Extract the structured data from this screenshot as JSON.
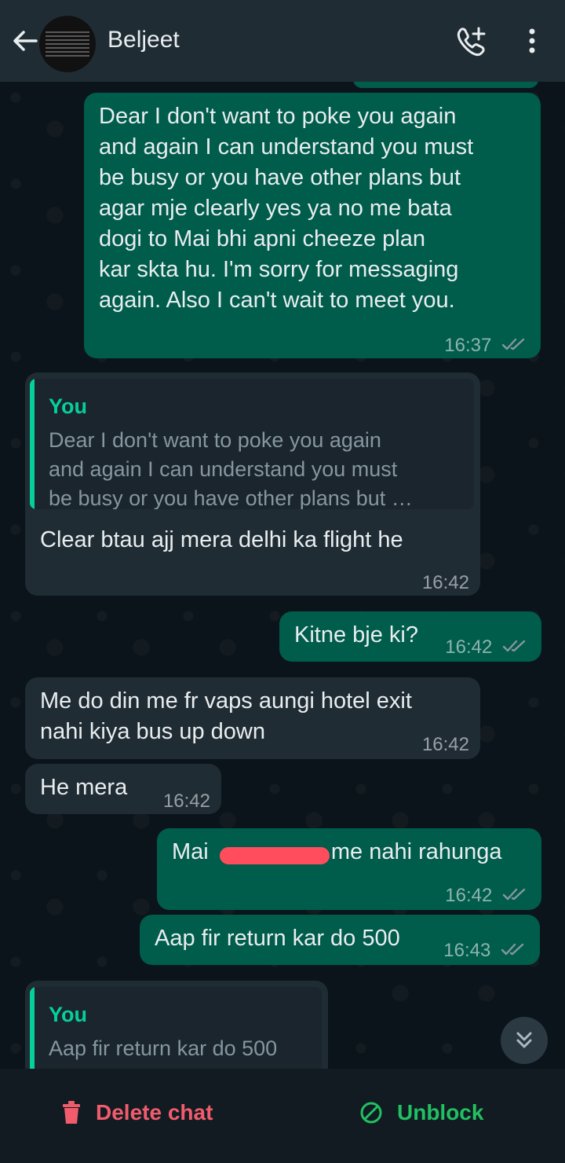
{
  "header": {
    "contact_name": "Beljeet"
  },
  "messages": [
    {
      "direction": "out",
      "text": "Dear I don't want to poke you again and again I can understand you must be busy or you have other plans but agar mje clearly yes ya no me bata dogi to Mai bhi apni cheeze plan kar skta hu. I'm sorry for messaging again. Also I can't wait to meet you.",
      "lines": [
        "Dear I don't want to poke you again",
        "and again I can understand you must",
        "be busy or you have other plans but",
        "agar mje clearly yes ya no me bata",
        "dogi to Mai bhi apni cheeze plan",
        "kar skta hu. I'm sorry for messaging",
        "again. Also I can't wait to meet you."
      ],
      "time": "16:37"
    },
    {
      "direction": "in",
      "quote_name": "You",
      "quote_lines": [
        "Dear I don't want to poke you again",
        "and again I can understand you must",
        "be busy or you have other plans but …"
      ],
      "text": "Clear btau ajj mera delhi ka flight he",
      "time": "16:42"
    },
    {
      "direction": "out",
      "text": "Kitne bje ki?",
      "time": "16:42"
    },
    {
      "direction": "in",
      "lines": [
        "Me do din me fr vaps aungi hotel exit",
        "nahi kiya bus up down"
      ],
      "time": "16:42"
    },
    {
      "direction": "in",
      "text": "He mera",
      "time": "16:42"
    },
    {
      "direction": "out",
      "text_before": "Mai",
      "text_after": "me nahi rahunga",
      "time": "16:42"
    },
    {
      "direction": "out",
      "text": "Aap fir return kar do 500",
      "time": "16:43"
    },
    {
      "direction": "in",
      "quote_name": "You",
      "quote_text": "Aap fir return kar do 500"
    }
  ],
  "bottom_bar": {
    "delete_label": "Delete chat",
    "unblock_label": "Unblock"
  },
  "colors": {
    "header_bg": "#1f2c34",
    "outgoing_bubble": "#005c4b",
    "incoming_bubble": "#1f2c34",
    "quote_accent": "#06cf9c",
    "delete_red": "#f15c6d",
    "unblock_green": "#21c063"
  },
  "icons": [
    "back-arrow-icon",
    "add-call-icon",
    "more-vert-icon",
    "double-check-icon",
    "trash-icon",
    "unblock-icon",
    "double-chevron-down-icon"
  ]
}
